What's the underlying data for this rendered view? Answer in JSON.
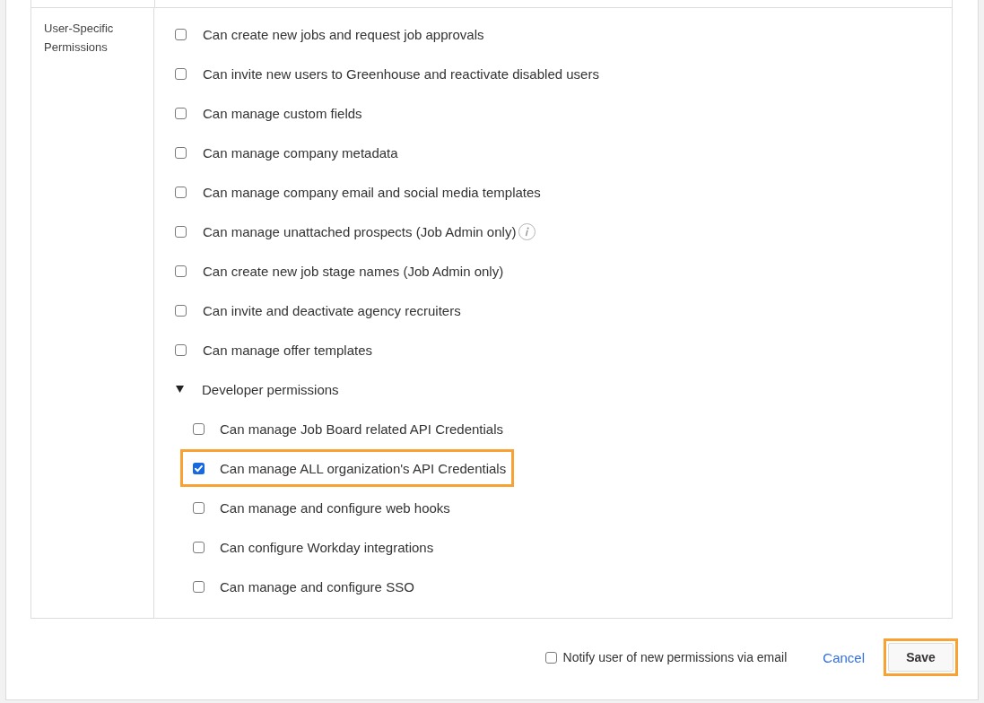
{
  "permissions_table": {
    "section_label": "User-Specific Permissions",
    "items": [
      {
        "kind": "checkbox",
        "label": "Can create new jobs and request job approvals",
        "checked": false,
        "info": false,
        "highlighted": false
      },
      {
        "kind": "checkbox",
        "label": "Can invite new users to Greenhouse and reactivate disabled users",
        "checked": false,
        "info": false,
        "highlighted": false
      },
      {
        "kind": "checkbox",
        "label": "Can manage custom fields",
        "checked": false,
        "info": false,
        "highlighted": false
      },
      {
        "kind": "checkbox",
        "label": "Can manage company metadata",
        "checked": false,
        "info": false,
        "highlighted": false
      },
      {
        "kind": "checkbox",
        "label": "Can manage company email and social media templates",
        "checked": false,
        "info": false,
        "highlighted": false
      },
      {
        "kind": "checkbox",
        "label": "Can manage unattached prospects (Job Admin only)",
        "checked": false,
        "info": true,
        "highlighted": false
      },
      {
        "kind": "checkbox",
        "label": "Can create new job stage names (Job Admin only)",
        "checked": false,
        "info": false,
        "highlighted": false
      },
      {
        "kind": "checkbox",
        "label": "Can invite and deactivate agency recruiters",
        "checked": false,
        "info": false,
        "highlighted": false
      },
      {
        "kind": "checkbox",
        "label": "Can manage offer templates",
        "checked": false,
        "info": false,
        "highlighted": false
      },
      {
        "kind": "group",
        "label": "Developer permissions",
        "expanded": true,
        "children": [
          {
            "kind": "checkbox",
            "label": "Can manage Job Board related API Credentials",
            "checked": false,
            "info": false,
            "highlighted": false
          },
          {
            "kind": "checkbox",
            "label": "Can manage ALL organization's API Credentials",
            "checked": true,
            "info": false,
            "highlighted": true
          },
          {
            "kind": "checkbox",
            "label": "Can manage and configure web hooks",
            "checked": false,
            "info": false,
            "highlighted": false
          },
          {
            "kind": "checkbox",
            "label": "Can configure Workday integrations",
            "checked": false,
            "info": false,
            "highlighted": false
          },
          {
            "kind": "checkbox",
            "label": "Can manage and configure SSO",
            "checked": false,
            "info": false,
            "highlighted": false
          }
        ]
      }
    ]
  },
  "footer": {
    "notify": {
      "label": "Notify user of new permissions via email",
      "checked": false
    },
    "cancel": "Cancel",
    "save": {
      "label": "Save",
      "highlighted": true
    }
  }
}
